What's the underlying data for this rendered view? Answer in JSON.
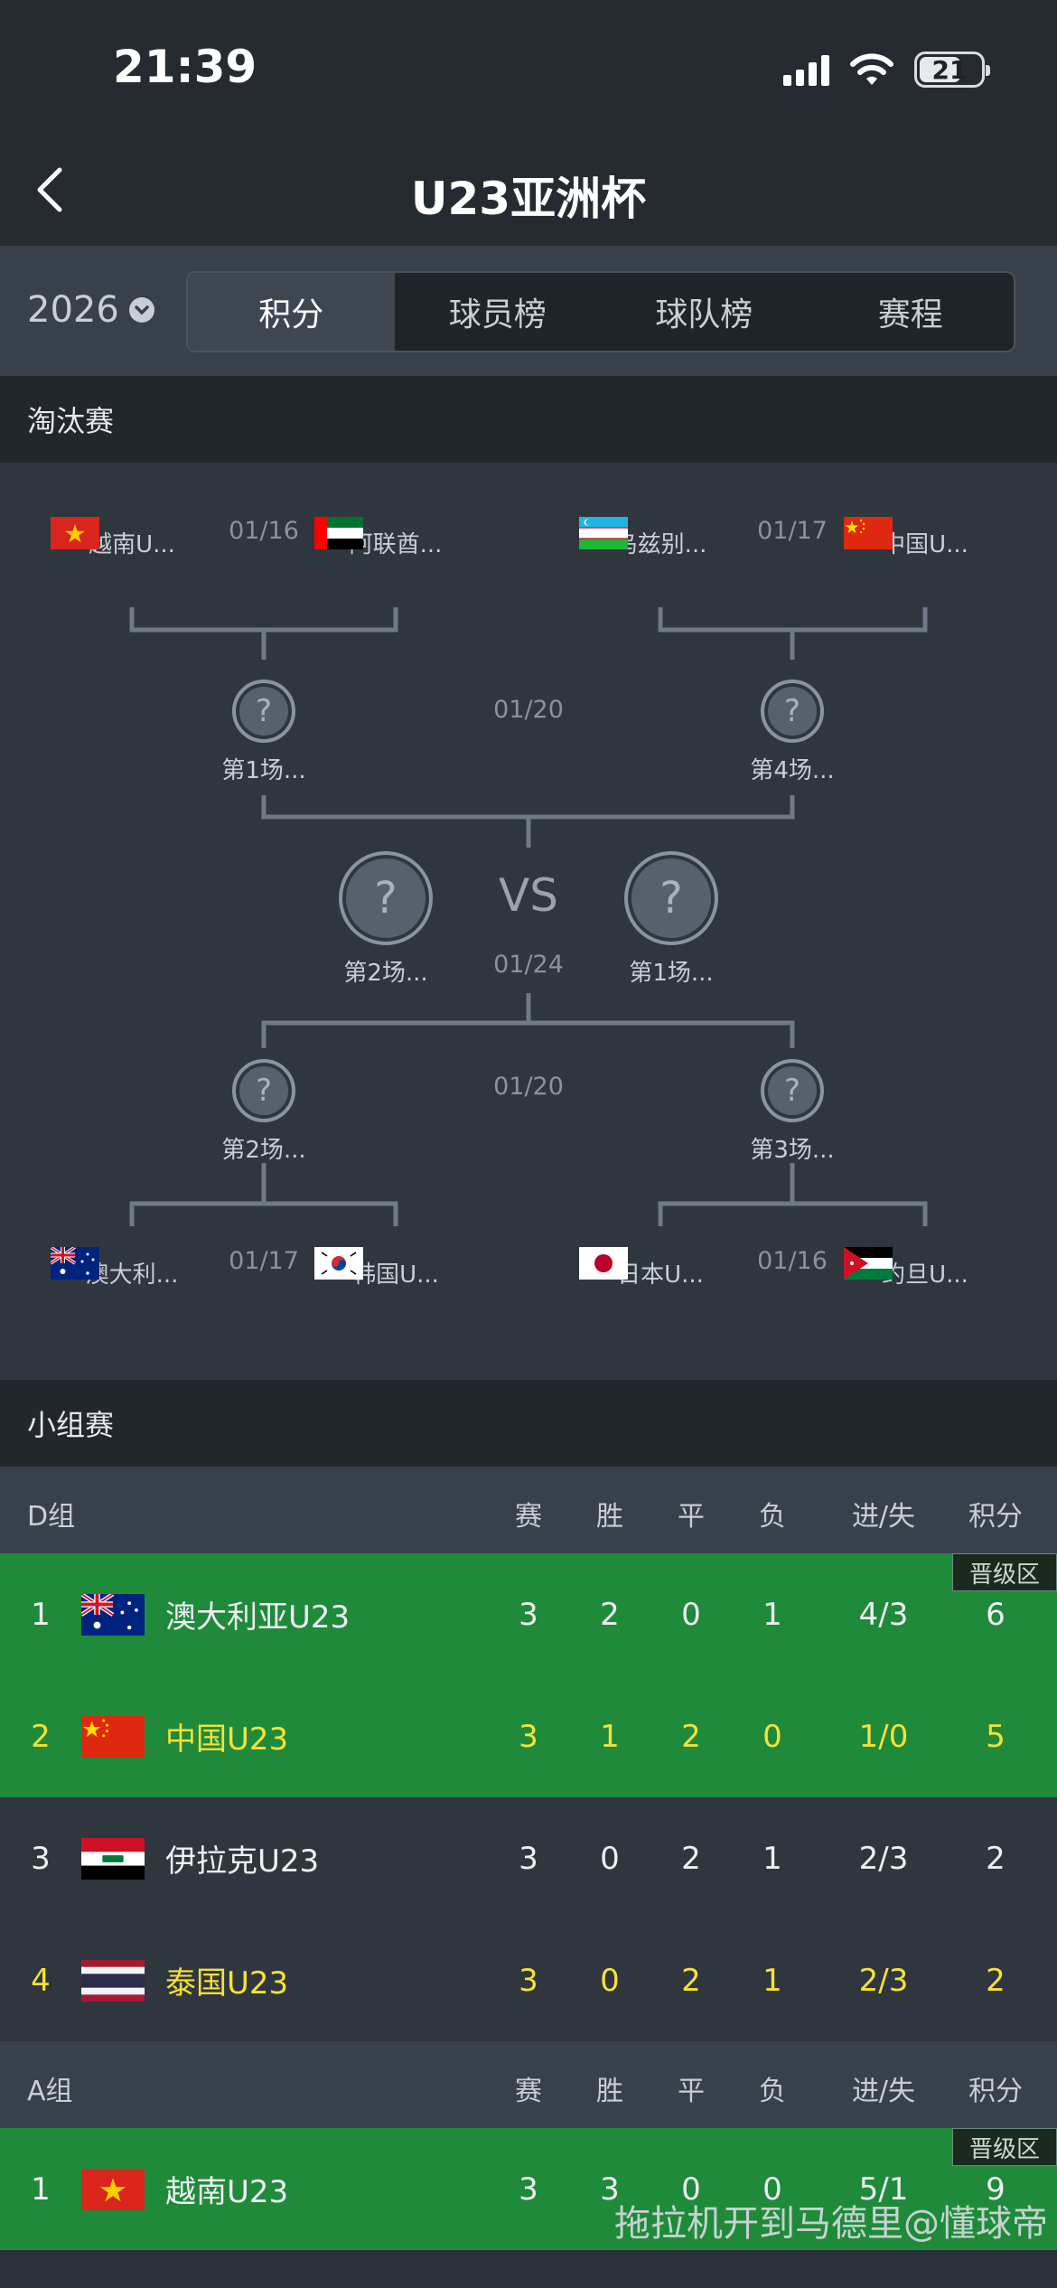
{
  "status": {
    "time": "21:39",
    "battery": "21"
  },
  "header": {
    "title": "U23亚洲杯"
  },
  "tabbar": {
    "year": "2026",
    "tabs": [
      {
        "label": "积分",
        "active": true
      },
      {
        "label": "球员榜",
        "active": false
      },
      {
        "label": "球队榜",
        "active": false
      },
      {
        "label": "赛程",
        "active": false
      }
    ]
  },
  "knockout": {
    "title": "淘汰赛",
    "top_left": {
      "date": "01/16",
      "team_a": "越南U...",
      "team_b": "阿联酋..."
    },
    "top_right": {
      "date": "01/17",
      "team_a": "乌兹别...",
      "team_b": "中国U..."
    },
    "semi_top": {
      "date": "01/20",
      "team_a": "第1场...",
      "team_b": "第4场..."
    },
    "final": {
      "vs": "VS",
      "date": "01/24",
      "team_a": "第2场...",
      "team_b": "第1场..."
    },
    "semi_bottom": {
      "date": "01/20",
      "team_a": "第2场...",
      "team_b": "第3场..."
    },
    "bottom_left": {
      "date": "01/17",
      "team_a": "澳大利...",
      "team_b": "韩国U..."
    },
    "bottom_right": {
      "date": "01/16",
      "team_a": "日本U...",
      "team_b": "约旦U..."
    },
    "placeholder": "?"
  },
  "groups_title": "小组赛",
  "columns": [
    "赛",
    "胜",
    "平",
    "负",
    "进/失",
    "积分"
  ],
  "promo_label": "晋级区",
  "group_d": {
    "name": "D组",
    "rows": [
      {
        "rank": "1",
        "team": "澳大利亚U23",
        "p": "3",
        "w": "2",
        "d": "0",
        "l": "1",
        "gd": "4/3",
        "pts": "6"
      },
      {
        "rank": "2",
        "team": "中国U23",
        "p": "3",
        "w": "1",
        "d": "2",
        "l": "0",
        "gd": "1/0",
        "pts": "5"
      },
      {
        "rank": "3",
        "team": "伊拉克U23",
        "p": "3",
        "w": "0",
        "d": "2",
        "l": "1",
        "gd": "2/3",
        "pts": "2"
      },
      {
        "rank": "4",
        "team": "泰国U23",
        "p": "3",
        "w": "0",
        "d": "2",
        "l": "1",
        "gd": "2/3",
        "pts": "2"
      }
    ]
  },
  "group_a": {
    "name": "A组",
    "rows": [
      {
        "rank": "1",
        "team": "越南U23",
        "p": "3",
        "w": "3",
        "d": "0",
        "l": "0",
        "gd": "5/1",
        "pts": "9"
      }
    ]
  },
  "watermark": "拖拉机开到马德里@懂球帝"
}
